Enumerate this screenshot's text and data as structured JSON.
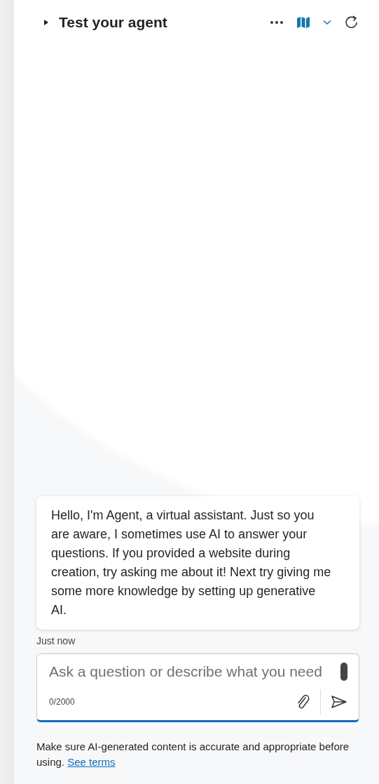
{
  "header": {
    "title": "Test your agent",
    "expanded": false
  },
  "message": {
    "text": "Hello, I'm Agent, a virtual assistant. Just so you are aware, I sometimes use AI to answer your questions. If you provided a website during creation, try asking me about it! Next try giving me some more knowledge by setting up generative AI.",
    "time": "Just now"
  },
  "input": {
    "placeholder": "Ask a question or describe what you need",
    "counter": "0/2000"
  },
  "disclaimer": {
    "text": "Make sure AI-generated content is accurate and appropriate before using.",
    "link": "See terms"
  }
}
